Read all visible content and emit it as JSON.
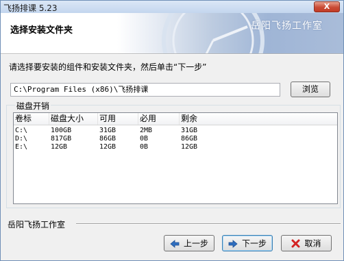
{
  "window": {
    "title": "飞扬排课 5.23",
    "close_glyph": "X"
  },
  "header": {
    "step_title": "选择安装文件夹",
    "brand": "岳阳飞扬工作室"
  },
  "instruction": "请选择要安装的组件和安装文件夹，然后单击“下一步”",
  "install_path": {
    "value": "C:\\Program Files (x86)\\飞扬排课"
  },
  "browse_label": "浏览",
  "disk_space": {
    "group_label": "磁盘开销",
    "columns": [
      "卷标",
      "磁盘大小",
      "可用",
      "必用",
      "剩余"
    ],
    "rows": [
      [
        "C:\\",
        "100GB",
        "31GB",
        "2MB",
        "31GB"
      ],
      [
        "D:\\",
        "817GB",
        "86GB",
        "0B",
        "86GB"
      ],
      [
        "E:\\",
        "12GB",
        "12GB",
        "0B",
        "12GB"
      ]
    ]
  },
  "footer": {
    "brand": "岳阳飞扬工作室",
    "back_label": "上一步",
    "next_label": "下一步",
    "cancel_label": "取消"
  },
  "colors": {
    "accent": "#2f6ebf",
    "cancel_icon": "#d32222"
  },
  "icons": {
    "back": "left-arrow-icon",
    "next": "right-arrow-icon",
    "cancel": "cross-icon"
  }
}
